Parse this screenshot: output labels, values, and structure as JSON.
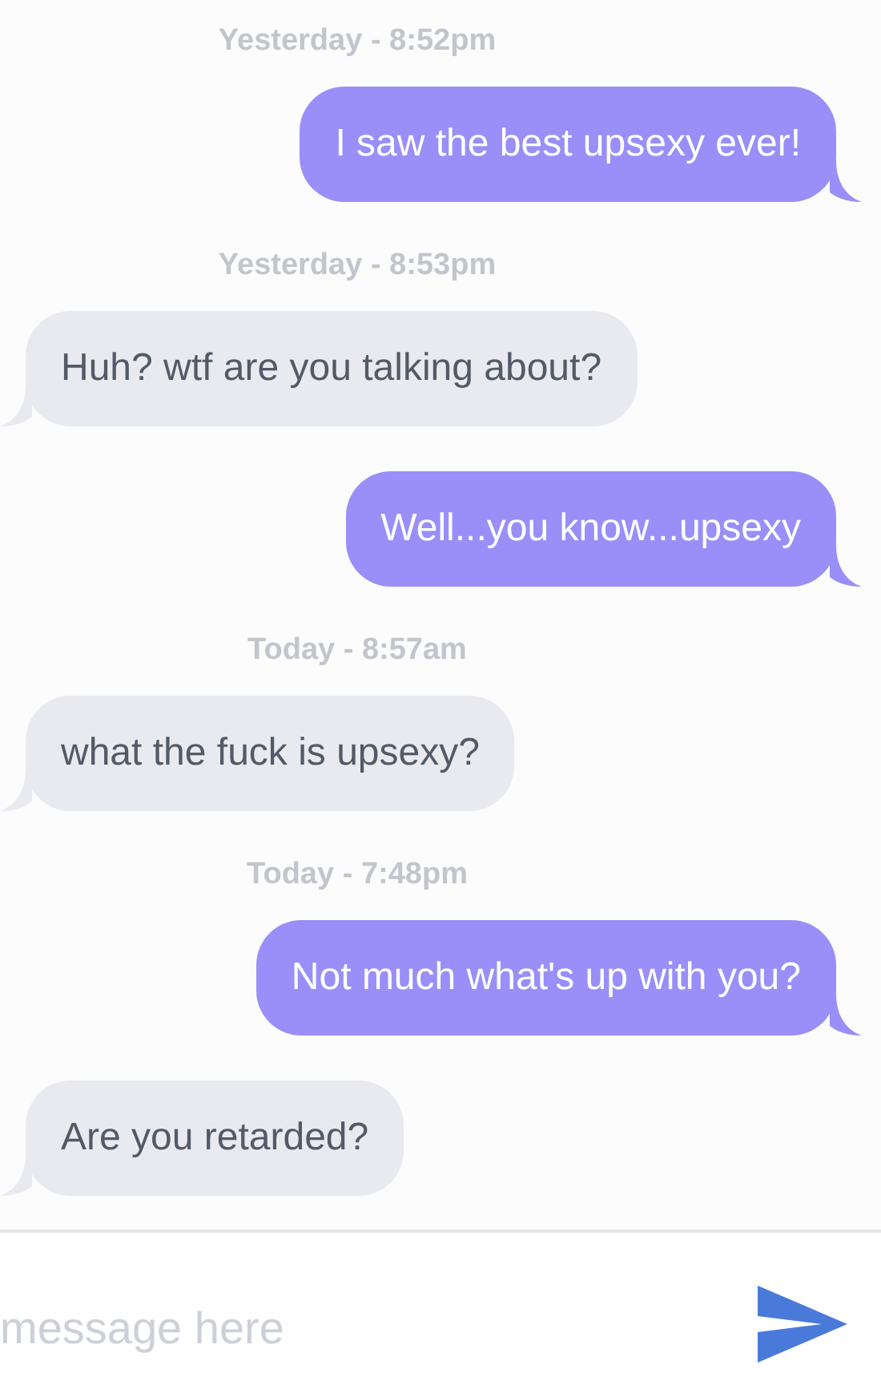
{
  "messages": [
    {
      "kind": "timestamp",
      "text": "Yesterday - 8:52pm"
    },
    {
      "kind": "sent",
      "text": "I saw the best upsexy ever!"
    },
    {
      "kind": "timestamp",
      "text": "Yesterday - 8:53pm"
    },
    {
      "kind": "received",
      "text": "Huh? wtf are you talking about?"
    },
    {
      "kind": "sent",
      "text": "Well...you know...upsexy"
    },
    {
      "kind": "timestamp",
      "text": "Today - 8:57am"
    },
    {
      "kind": "received",
      "text": "what the fuck is upsexy?"
    },
    {
      "kind": "timestamp",
      "text": "Today - 7:48pm"
    },
    {
      "kind": "sent",
      "text": "Not much what's up with you?"
    },
    {
      "kind": "received",
      "text": "Are you retarded?"
    }
  ],
  "composer": {
    "placeholder": "message here"
  }
}
